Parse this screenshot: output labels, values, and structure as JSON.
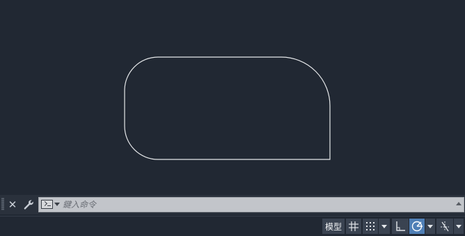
{
  "command_line": {
    "placeholder": "鍵入命令",
    "close_glyph": "✕"
  },
  "status_bar": {
    "model_label": "模型"
  },
  "colors": {
    "background": "#212833",
    "drawing_stroke": "#e6e8ea",
    "command_input_bg": "#c2c5ca",
    "active_toggle": "#4f7fb6"
  },
  "icons": [
    "grip-icon",
    "close-icon",
    "wrench-icon",
    "command-prompt-icon",
    "grid-icon",
    "snap-icon",
    "ortho-icon",
    "polar-tracking-icon",
    "object-snap-tracking-icon",
    "chevron-down-icon",
    "chevron-up-icon"
  ]
}
